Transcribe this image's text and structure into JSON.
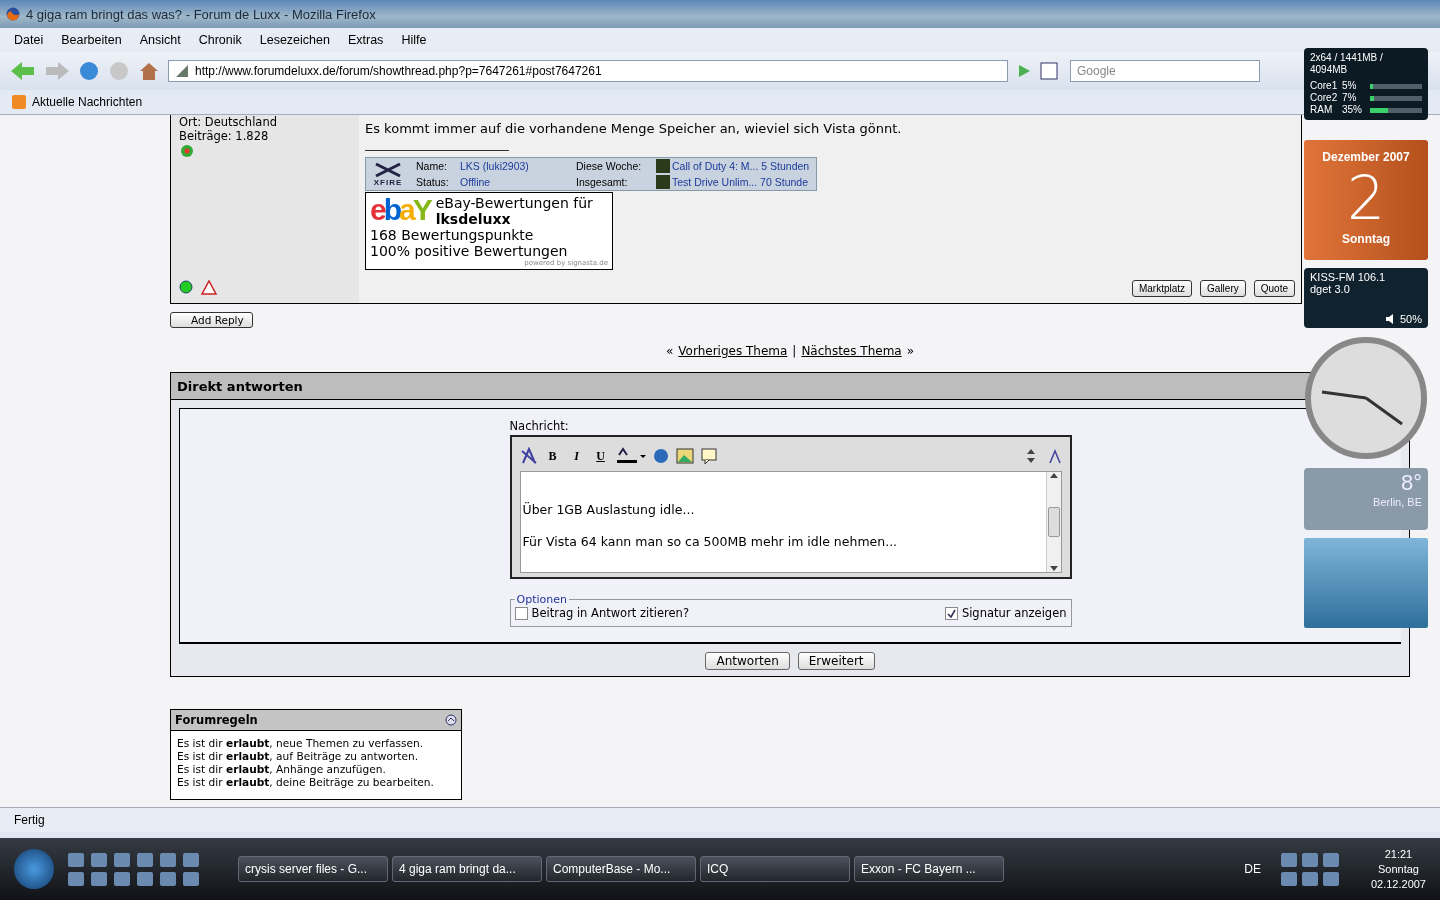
{
  "window": {
    "title": "4 giga ram bringt das was? - Forum de Luxx - Mozilla Firefox"
  },
  "menu": [
    "Datei",
    "Bearbeiten",
    "Ansicht",
    "Chronik",
    "Lesezeichen",
    "Extras",
    "Hilfe"
  ],
  "address": {
    "url": "http://www.forumdeluxx.de/forum/showthread.php?p=7647261#post7647261"
  },
  "search": {
    "placeholder": "Google"
  },
  "bookmarks": [
    "Aktuelle Nachrichten"
  ],
  "post": {
    "user_info": [
      "Ort: Deutschland",
      "Beiträge: 1.828"
    ],
    "message": "Es kommt immer auf die vorhandene Menge Speicher an, wieviel sich Vista gönnt.",
    "xfire": {
      "logo": "XFIRE",
      "fields": [
        {
          "label": "Name:",
          "value": "LKS (luki2903)"
        },
        {
          "label": "Status:",
          "value": "Offline"
        }
      ],
      "games": [
        {
          "label": "Diese Woche:",
          "game": "Call of Duty 4: M...",
          "time": "5 Stunden"
        },
        {
          "label": "Insgesamt:",
          "game": "Test Drive Unlim...",
          "time": "70 Stunde"
        }
      ]
    },
    "ebay": {
      "logo": [
        "e",
        "b",
        "a",
        "Y"
      ],
      "title": "eBay-Bewertungen für",
      "user": "lksdeluxx",
      "points": "168 Bewertungspunkte",
      "positive": "100% positive Bewertungen",
      "powered": "powered by signasta.de"
    },
    "buttons": [
      "Marktplatz",
      "Gallery",
      "Quote"
    ]
  },
  "add_reply": "Add Reply",
  "thread_nav": {
    "prev_mark": "«",
    "prev": "Vorheriges Thema",
    "sep": "|",
    "next": "Nächstes Thema",
    "next_mark": "»"
  },
  "quick_reply": {
    "title": "Direkt antworten",
    "label": "Nachricht:",
    "format_buttons": [
      "B",
      "I",
      "U"
    ],
    "lines": [
      "Über 1GB Auslastung idle...",
      "Für Vista 64 kann man so ca 500MB mehr im idle nehmen..."
    ],
    "options_legend": "Optionen",
    "options": [
      {
        "label": "Beitrag in Antwort zitieren?",
        "checked": false
      },
      {
        "label": "Signatur anzeigen",
        "checked": true
      }
    ],
    "buttons": [
      "Antworten",
      "Erweitert"
    ]
  },
  "rules": {
    "title": "Forumregeln",
    "lines": [
      "Es ist dir **erlaubt**, neue Themen zu verfassen.",
      "Es ist dir **erlaubt**, auf Beiträge zu antworten.",
      "Es ist dir **erlaubt**, Anhänge anzufügen.",
      "Es ist dir **erlaubt**, deine Beiträge zu bearbeiten."
    ]
  },
  "status_bar": "Fertig",
  "gadgets": {
    "cpu": {
      "header": "2x64 / 1441MB / 4094MB",
      "rows": [
        {
          "label": "Core1",
          "reading": "5%",
          "level": 0.05
        },
        {
          "label": "Core2",
          "reading": "7%",
          "level": 0.07
        },
        {
          "label": "RAM",
          "reading": "35%",
          "level": 0.35
        }
      ]
    },
    "calendar": {
      "month": "Dezember 2007",
      "day": "2",
      "weekday": "Sonntag"
    },
    "radio": {
      "station": "KISS-FM 106.1",
      "subtitle": "dget 3.0",
      "volume": "50%"
    },
    "weather": {
      "temp": "8°",
      "city": "Berlin, BE"
    }
  },
  "taskbar": {
    "tasks": [
      "crysis server files - G...",
      "4 giga ram bringt da...",
      "ComputerBase - Mo...",
      "ICQ",
      "Exxon - FC Bayern ..."
    ],
    "language": "DE",
    "time": "21:21",
    "weekday": "Sonntag",
    "date": "02.12.2007"
  }
}
